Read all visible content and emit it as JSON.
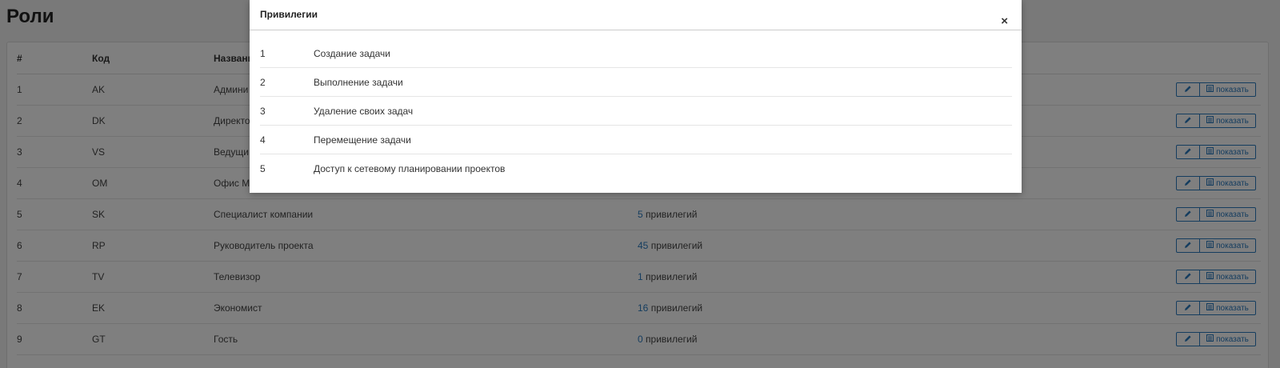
{
  "page": {
    "title": "Роли"
  },
  "table": {
    "headers": {
      "num": "#",
      "code": "Код",
      "name": "Название"
    },
    "rows": [
      {
        "num": "1",
        "code": "AK",
        "name": "Админи",
        "count": "",
        "count_suffix": ""
      },
      {
        "num": "2",
        "code": "DK",
        "name": "Директо",
        "count": "",
        "count_suffix": ""
      },
      {
        "num": "3",
        "code": "VS",
        "name": "Ведущи",
        "count": "",
        "count_suffix": ""
      },
      {
        "num": "4",
        "code": "OM",
        "name": "Офис М",
        "count": "",
        "count_suffix": ""
      },
      {
        "num": "5",
        "code": "SK",
        "name": "Специалист компании",
        "count": "5",
        "count_suffix": " привилегий"
      },
      {
        "num": "6",
        "code": "RP",
        "name": "Руководитель проекта",
        "count": "45",
        "count_suffix": " привилегий"
      },
      {
        "num": "7",
        "code": "TV",
        "name": "Телевизор",
        "count": "1",
        "count_suffix": " привилегий"
      },
      {
        "num": "8",
        "code": "EK",
        "name": "Экономист",
        "count": "16",
        "count_suffix": " привилегий"
      },
      {
        "num": "9",
        "code": "GT",
        "name": "Гость",
        "count": "0",
        "count_suffix": " привилегий"
      }
    ],
    "show_label": "показать"
  },
  "modal": {
    "title": "Привилегии",
    "close_glyph": "×",
    "items": [
      {
        "num": "1",
        "name": "Создание задачи"
      },
      {
        "num": "2",
        "name": "Выполнение задачи"
      },
      {
        "num": "3",
        "name": "Удаление своих задач"
      },
      {
        "num": "4",
        "name": "Перемещение задачи"
      },
      {
        "num": "5",
        "name": "Доступ к сетевому планировании проектов"
      }
    ]
  },
  "icons": {
    "edit": "pencil-icon",
    "show": "list-icon",
    "close": "close-icon"
  },
  "colors": {
    "accent": "#2a7abf",
    "overlay": "rgba(0,0,0,0.5)"
  }
}
